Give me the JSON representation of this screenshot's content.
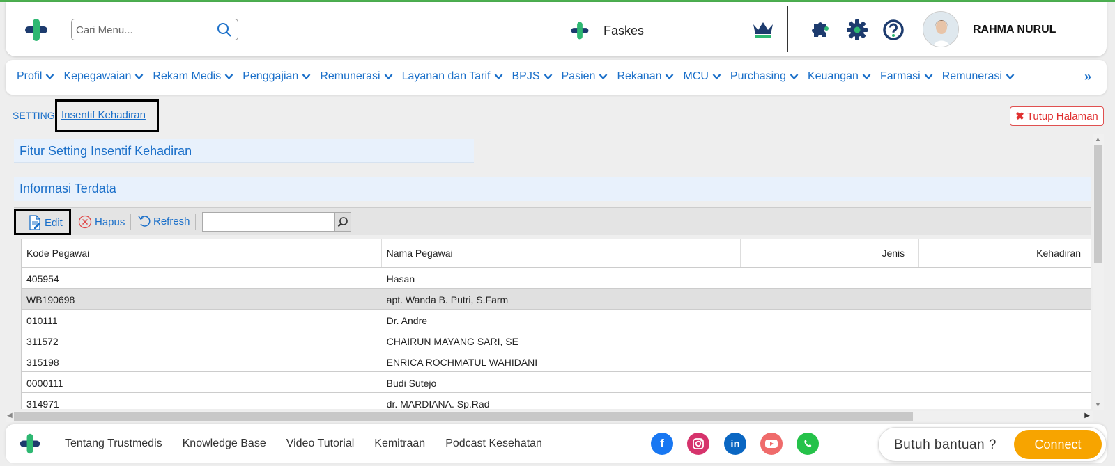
{
  "colors": {
    "accent": "#1a6fc9",
    "brand_green": "#2eb872",
    "brand_navy": "#1d3b6e",
    "connect": "#f7a400",
    "close": "#e03030"
  },
  "header": {
    "search_placeholder": "Cari Menu...",
    "facility": "Faskes",
    "user_name": "RAHMA NURUL",
    "icons": [
      "logo-icon",
      "search-icon",
      "crown-icon",
      "puzzle-icon",
      "gear-icon",
      "help-icon",
      "avatar"
    ]
  },
  "menu": {
    "items": [
      {
        "label": "Profil"
      },
      {
        "label": "Kepegawaian"
      },
      {
        "label": "Rekam Medis"
      },
      {
        "label": "Penggajian"
      },
      {
        "label": "Remunerasi"
      },
      {
        "label": "Layanan dan Tarif"
      },
      {
        "label": "BPJS"
      },
      {
        "label": "Pasien"
      },
      {
        "label": "Rekanan"
      },
      {
        "label": "MCU"
      },
      {
        "label": "Purchasing"
      },
      {
        "label": "Keuangan"
      },
      {
        "label": "Farmasi"
      },
      {
        "label": "Remunerasi"
      }
    ],
    "more": "»"
  },
  "breadcrumb": {
    "root": "SETTING",
    "active": "Insentif Kehadiran"
  },
  "close_page": "Tutup Halaman",
  "sections": {
    "setting_title": "Fitur Setting Insentif Kehadiran",
    "info_title": "Informasi Terdata"
  },
  "toolbar": {
    "edit": "Edit",
    "delete": "Hapus",
    "refresh": "Refresh",
    "search_value": ""
  },
  "table": {
    "columns": [
      "Kode Pegawai",
      "Nama Pegawai",
      "Jenis",
      "Kehadiran"
    ],
    "rows": [
      {
        "kode": "405954",
        "nama": "Hasan",
        "selected": false
      },
      {
        "kode": "WB190698",
        "nama": "apt. Wanda B. Putri, S.Farm",
        "selected": true
      },
      {
        "kode": "010111",
        "nama": "Dr. Andre",
        "selected": false
      },
      {
        "kode": "311572",
        "nama": "CHAIRUN MAYANG SARI, SE",
        "selected": false
      },
      {
        "kode": "315198",
        "nama": "ENRICA ROCHMATUL WAHIDANI",
        "selected": false
      },
      {
        "kode": "0000111",
        "nama": "Budi Sutejo",
        "selected": false
      },
      {
        "kode": "314971",
        "nama": "dr. MARDIANA. Sp.Rad",
        "selected": false
      }
    ]
  },
  "footer": {
    "links": [
      "Tentang Trustmedis",
      "Knowledge Base",
      "Video Tutorial",
      "Kemitraan",
      "Podcast Kesehatan"
    ],
    "social": [
      "facebook-icon",
      "instagram-icon",
      "linkedin-icon",
      "youtube-icon",
      "whatsapp-icon"
    ],
    "help_text": "Butuh bantuan ?",
    "connect": "Connect"
  }
}
